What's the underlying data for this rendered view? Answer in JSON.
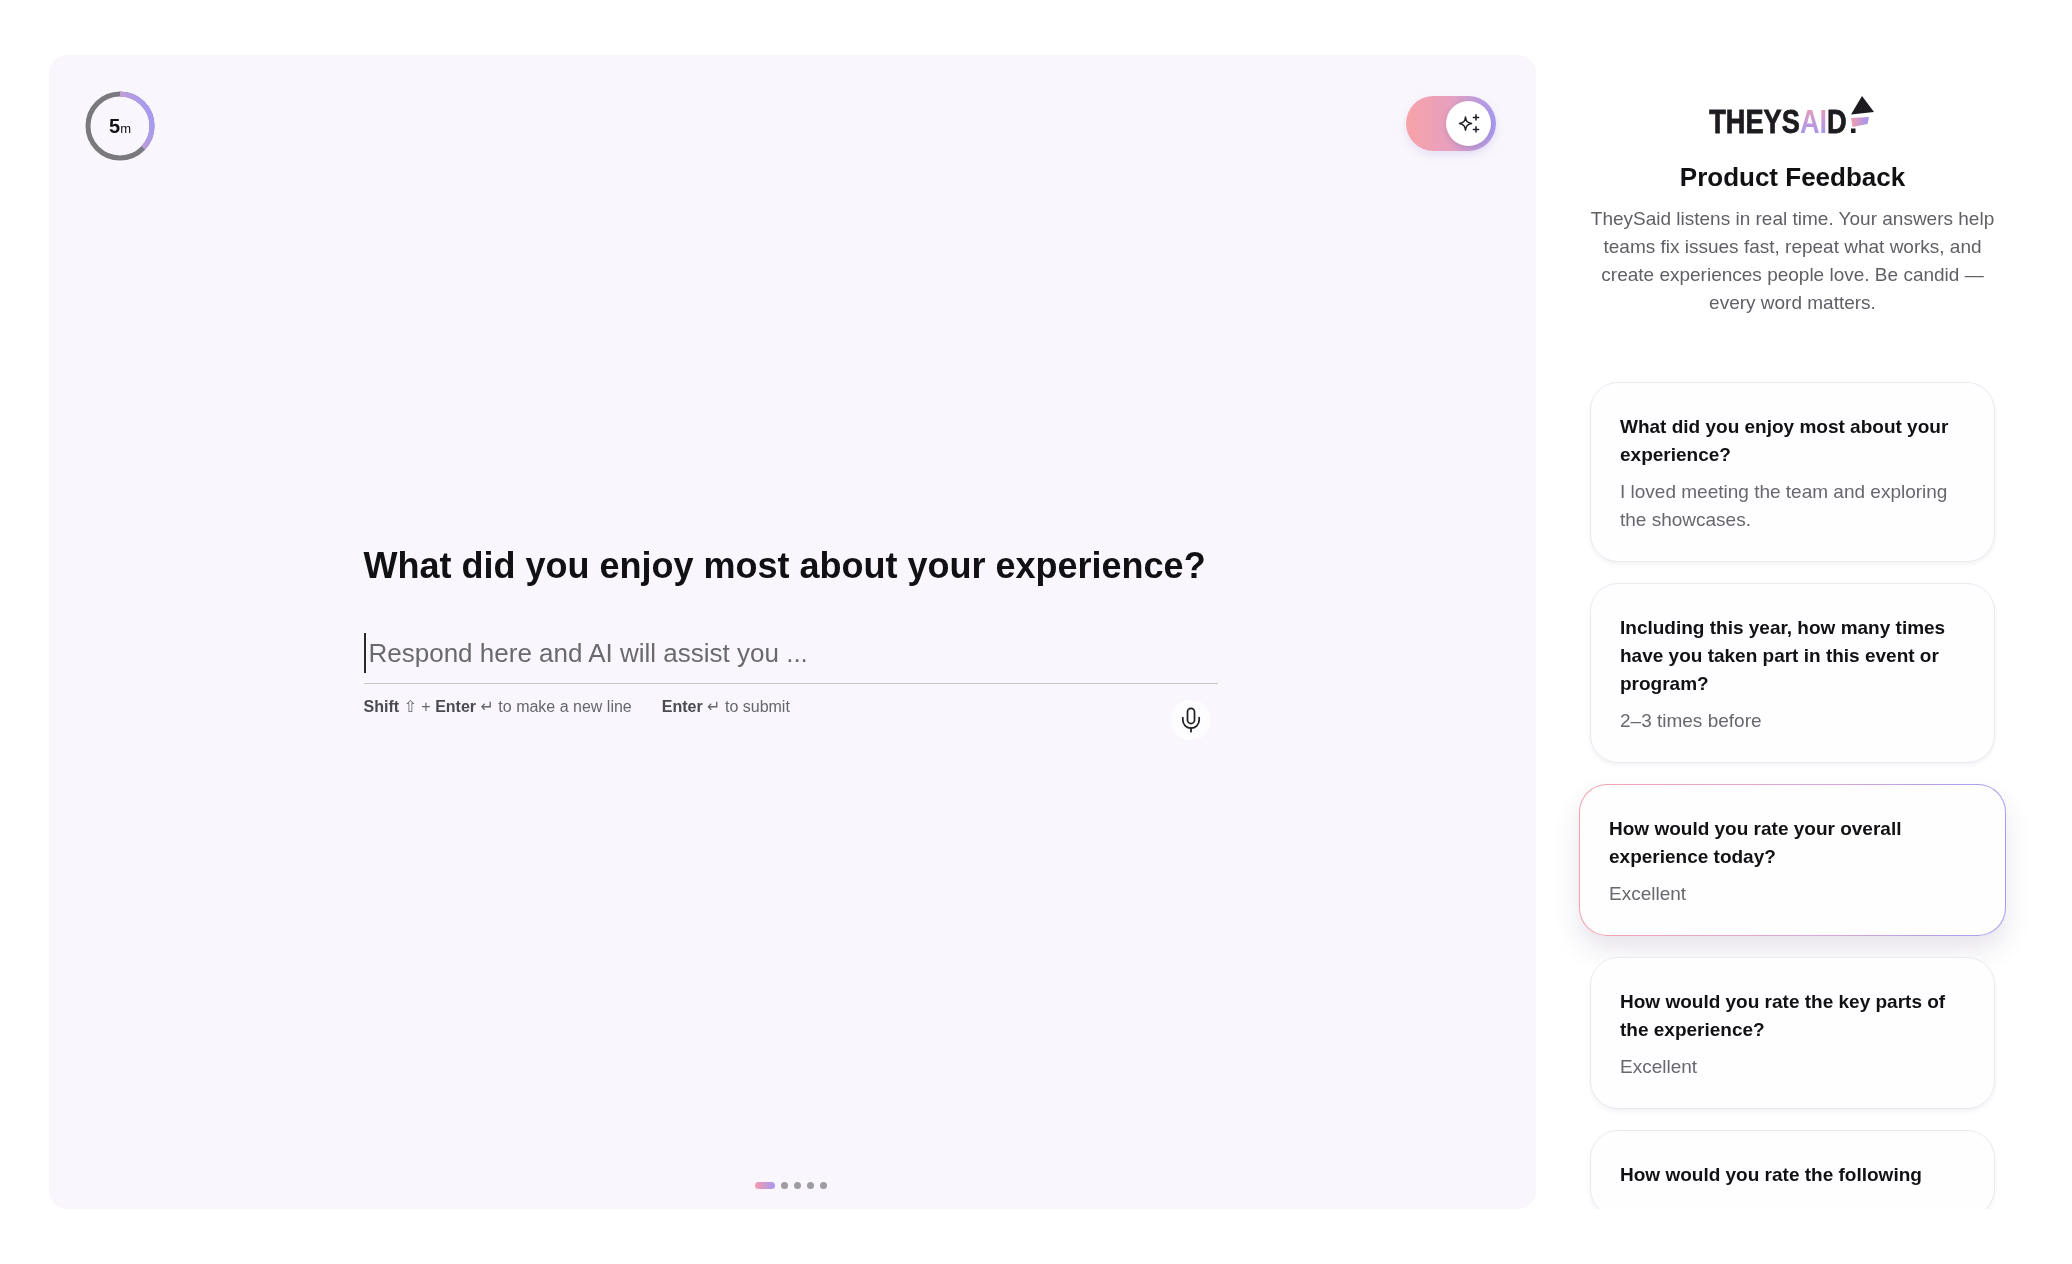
{
  "timer": {
    "value": "5",
    "unit": "m",
    "level": 0.37
  },
  "ai_toggle": {
    "on": true
  },
  "question": {
    "title": "What did you enjoy most about your experience?",
    "placeholder": "Respond here and AI will assist you ...",
    "hints": [
      "**Shift** ⇧ + **Enter** ↵ to make a new line",
      "**Enter** ↵ to submit"
    ]
  },
  "steps": [
    {
      "selected": true
    },
    {
      "selected": false
    },
    {
      "selected": false
    },
    {
      "selected": false
    },
    {
      "selected": false
    }
  ],
  "sidebar": {
    "logo": [
      {
        "text": "THEYS",
        "accent": false
      },
      {
        "text": "AI",
        "accent": true
      },
      {
        "text": "D",
        "accent": false
      }
    ],
    "title": "Product Feedback",
    "description": "TheySaid listens in real time. Your answers help teams fix issues fast, repeat what works, and create experiences people love. Be candid — every word matters.",
    "questions": [
      {
        "title": "What did you enjoy most about your experience?",
        "answer": "I loved meeting the team and exploring the showcases.",
        "selected": false
      },
      {
        "title": "Including this year, how many times have you taken part in this event or program?",
        "answer": "2–3 times before",
        "selected": false
      },
      {
        "title": "How would you rate your overall experience today?",
        "answer": "Excellent",
        "selected": true
      },
      {
        "title": "How would you rate the key parts of the experience?",
        "answer": "Excellent",
        "selected": false
      },
      {
        "title": "How would you rate the following",
        "selected": false
      }
    ]
  }
}
